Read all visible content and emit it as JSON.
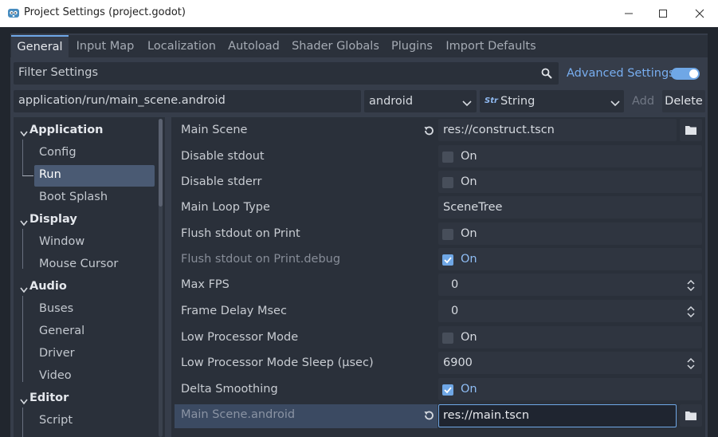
{
  "window": {
    "title": "Project Settings (project.godot)"
  },
  "tabs": [
    "General",
    "Input Map",
    "Localization",
    "Autoload",
    "Shader Globals",
    "Plugins",
    "Import Defaults"
  ],
  "filter": {
    "placeholder": "Filter Settings",
    "advanced_label": "Advanced Settings",
    "advanced_enabled": true
  },
  "path_row": {
    "path": "application/run/main_scene.android",
    "feature": "android",
    "type_icon": "Str",
    "type": "String",
    "add_label": "Add",
    "delete_label": "Delete"
  },
  "tree": {
    "application": {
      "label": "Application",
      "items": [
        "Config",
        "Run",
        "Boot Splash"
      ]
    },
    "display": {
      "label": "Display",
      "items": [
        "Window",
        "Mouse Cursor"
      ]
    },
    "audio": {
      "label": "Audio",
      "items": [
        "Buses",
        "General",
        "Driver",
        "Video"
      ]
    },
    "editor": {
      "label": "Editor",
      "items": [
        "Script"
      ]
    },
    "selected": "Run"
  },
  "properties": {
    "main_scene": {
      "label": "Main Scene",
      "value": "res://construct.tscn"
    },
    "disable_stdout": {
      "label": "Disable stdout",
      "value": "On",
      "checked": false
    },
    "disable_stderr": {
      "label": "Disable stderr",
      "value": "On",
      "checked": false
    },
    "main_loop_type": {
      "label": "Main Loop Type",
      "value": "SceneTree"
    },
    "flush_stdout": {
      "label": "Flush stdout on Print",
      "value": "On",
      "checked": false
    },
    "flush_stdout_debug": {
      "label": "Flush stdout on Print.debug",
      "value": "On",
      "checked": true
    },
    "max_fps": {
      "label": "Max FPS",
      "value": "0"
    },
    "frame_delay": {
      "label": "Frame Delay Msec",
      "value": "0"
    },
    "low_proc": {
      "label": "Low Processor Mode",
      "value": "On",
      "checked": false
    },
    "low_proc_sleep": {
      "label": "Low Processor Mode Sleep (µsec)",
      "value": "6900"
    },
    "delta_smoothing": {
      "label": "Delta Smoothing",
      "value": "On",
      "checked": true
    },
    "main_scene_android": {
      "label": "Main Scene.android",
      "value": "res://main.tscn"
    }
  },
  "colors": {
    "accent": "#6fa7e6",
    "panel": "#363d4a",
    "field": "#2a303a",
    "selection": "#4a5a73"
  }
}
